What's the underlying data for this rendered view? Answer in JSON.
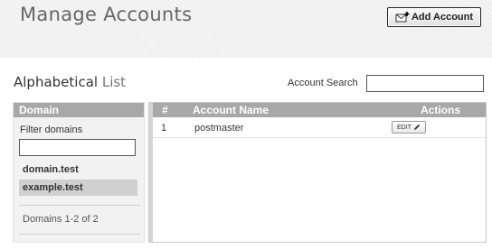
{
  "header": {
    "title": "Manage Accounts",
    "add_account_label": "Add Account"
  },
  "section": {
    "title_main": "Alphabetical",
    "title_sub": "List",
    "search_label": "Account Search",
    "search_value": ""
  },
  "sidebar": {
    "header": "Domain",
    "filter_label": "Filter domains",
    "filter_value": "",
    "domains": [
      {
        "name": "domain.test",
        "selected": false
      },
      {
        "name": "example.test",
        "selected": true
      }
    ],
    "count_text": "Domains 1-2 of 2"
  },
  "table": {
    "columns": [
      "#",
      "Account Name",
      "Actions"
    ],
    "rows": [
      {
        "num": "1",
        "name": "postmaster",
        "action": "EDIT"
      }
    ]
  },
  "icons": {
    "add_account": "envelope-plus-icon",
    "edit": "pencil-icon"
  }
}
